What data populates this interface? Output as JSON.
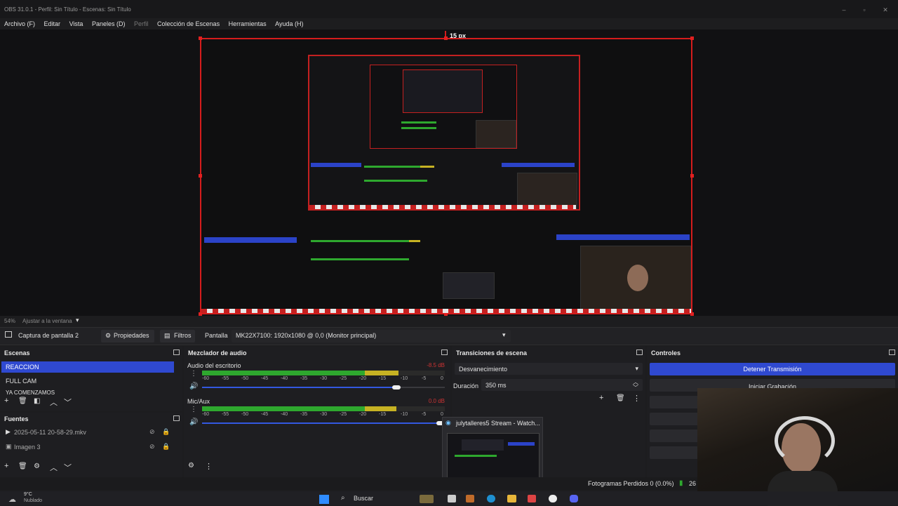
{
  "window": {
    "title": "OBS 31.0.1 - Perfil: Sin Título - Escenas: Sin Título"
  },
  "menu": [
    "Archivo (F)",
    "Editar",
    "Vista",
    "Paneles (D)",
    "Perfil",
    "Colección de Escenas",
    "Herramientas",
    "Ayuda (H)"
  ],
  "preview": {
    "spacing_label": "15 px",
    "zoom": "54%",
    "fit_label": "Ajustar a la ventana"
  },
  "source_toolbar": {
    "source_name": "Captura de pantalla 2",
    "properties": "Propiedades",
    "filters": "Filtros",
    "display_label": "Pantalla",
    "display_value": "MK22X7100: 1920x1080 @ 0,0 (Monitor principal)"
  },
  "scenes": {
    "title": "Escenas",
    "items": [
      "REACCION",
      "FULL CAM",
      "YA COMENZAMOS"
    ]
  },
  "sources": {
    "title": "Fuentes",
    "items": [
      "2025-05-11 20-58-29.mkv",
      "Imagen 3"
    ]
  },
  "mixer": {
    "title": "Mezclador de audio",
    "channels": [
      {
        "name": "Audio del escritorio",
        "db": "-8.5 dB",
        "level": 0.81,
        "volume": 0.8
      },
      {
        "name": "Mic/Aux",
        "db": "0.0 dB",
        "level": 0.8,
        "volume": 1.0
      }
    ],
    "ticks": [
      "-60",
      "-55",
      "-50",
      "-45",
      "-40",
      "-35",
      "-30",
      "-25",
      "-20",
      "-15",
      "-10",
      "-5",
      "0"
    ]
  },
  "transitions": {
    "title": "Transiciones de escena",
    "selected": "Desvanecimiento",
    "duration_label": "Duración",
    "duration_value": "350 ms"
  },
  "controls": {
    "title": "Controles",
    "stop_stream": "Detener Transmisión",
    "start_recording": "Iniciar Grabación"
  },
  "status": {
    "dropped_frames": "Fotogramas Perdidos 0 (0.0%)",
    "bitrate": "26"
  },
  "popup": {
    "title": "julytalleres5 Stream - Watch..."
  },
  "taskbar": {
    "weather_temp": "9°C",
    "weather_desc": "Nublado",
    "search": "Buscar"
  },
  "colors": {
    "accent": "#2f49d0",
    "selection_border": "#d51c1c",
    "meter_green": "#2ea82e",
    "meter_yellow": "#c6b223",
    "meter_red": "#cc3333"
  }
}
